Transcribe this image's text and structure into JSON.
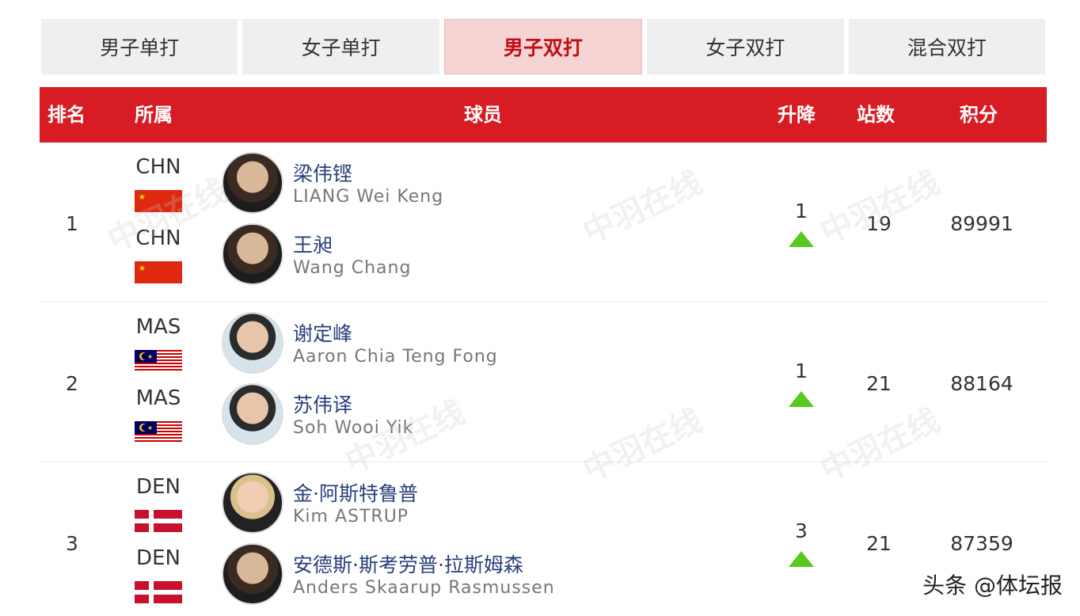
{
  "tabs": [
    {
      "label": "男子单打"
    },
    {
      "label": "女子单打"
    },
    {
      "label": "男子双打"
    },
    {
      "label": "女子双打"
    },
    {
      "label": "混合双打"
    }
  ],
  "active_tab": "男子双打",
  "columns": {
    "rank": "排名",
    "country": "所属",
    "player": "球员",
    "change": "升降",
    "events": "站数",
    "points": "积分"
  },
  "rows": [
    {
      "rank": "1",
      "change": "1",
      "trend": "up",
      "events": "19",
      "points": "89991",
      "players": [
        {
          "country": "CHN",
          "flag": "china-flag-icon",
          "cname": "梁伟铿",
          "ename": "LIANG Wei Keng"
        },
        {
          "country": "CHN",
          "flag": "china-flag-icon",
          "cname": "王昶",
          "ename": "Wang Chang"
        }
      ]
    },
    {
      "rank": "2",
      "change": "1",
      "trend": "up",
      "events": "21",
      "points": "88164",
      "players": [
        {
          "country": "MAS",
          "flag": "malaysia-flag-icon",
          "cname": "谢定峰",
          "ename": "Aaron Chia Teng Fong"
        },
        {
          "country": "MAS",
          "flag": "malaysia-flag-icon",
          "cname": "苏伟译",
          "ename": "Soh Wooi Yik"
        }
      ]
    },
    {
      "rank": "3",
      "change": "3",
      "trend": "up",
      "events": "21",
      "points": "87359",
      "players": [
        {
          "country": "DEN",
          "flag": "denmark-flag-icon",
          "cname": "金·阿斯特鲁普",
          "ename": "Kim ASTRUP"
        },
        {
          "country": "DEN",
          "flag": "denmark-flag-icon",
          "cname": "安德斯·斯考劳普·拉斯姆森",
          "ename": "Anders Skaarup Rasmussen"
        }
      ]
    }
  ],
  "watermark": "中羽在线",
  "source": "头条 @体坛报",
  "colors": {
    "header_red": "#d81c24",
    "active_tab_bg": "#f6d4d4",
    "up_green": "#5ac81e"
  }
}
